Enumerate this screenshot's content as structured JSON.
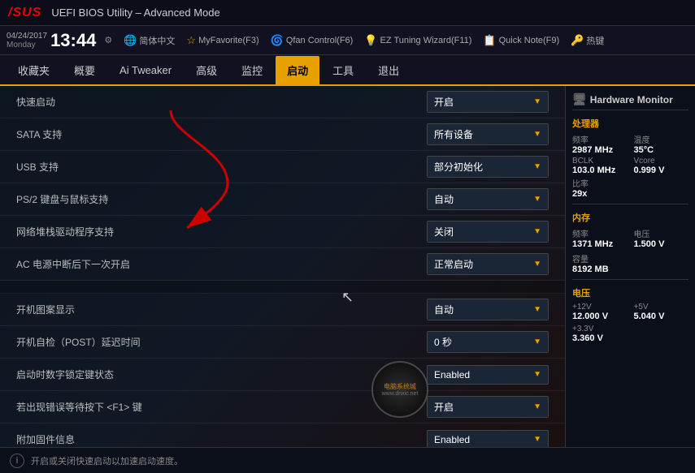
{
  "titlebar": {
    "logo": "/SUS",
    "title": "UEFI BIOS Utility – Advanced Mode"
  },
  "toolbar": {
    "datetime": "13:44",
    "date": "04/24/2017",
    "day": "Monday",
    "items": [
      {
        "icon": "🌐",
        "label": "简体中文"
      },
      {
        "icon": "⭐",
        "label": "MyFavorite(F3)"
      },
      {
        "icon": "🌀",
        "label": "Qfan Control(F6)"
      },
      {
        "icon": "💡",
        "label": "EZ Tuning Wizard(F11)"
      },
      {
        "icon": "📝",
        "label": "Quick Note(F9)"
      },
      {
        "icon": "🔑",
        "label": "热键"
      }
    ]
  },
  "nav": {
    "items": [
      {
        "label": "收藏夹",
        "active": false
      },
      {
        "label": "概要",
        "active": false
      },
      {
        "label": "Ai Tweaker",
        "active": false
      },
      {
        "label": "高级",
        "active": false
      },
      {
        "label": "监控",
        "active": false
      },
      {
        "label": "启动",
        "active": true
      },
      {
        "label": "工具",
        "active": false
      },
      {
        "label": "退出",
        "active": false
      }
    ]
  },
  "settings": {
    "rows": [
      {
        "type": "setting",
        "label": "快速启动",
        "value": "开启"
      },
      {
        "type": "setting",
        "label": "SATA 支持",
        "value": "所有设备"
      },
      {
        "type": "setting",
        "label": "USB 支持",
        "value": "部分初始化"
      },
      {
        "type": "setting",
        "label": "PS/2 键盘与鼠标支持",
        "value": "自动"
      },
      {
        "type": "setting",
        "label": "网络堆栈驱动程序支持",
        "value": "关闭"
      },
      {
        "type": "setting",
        "label": "AC 电源中断后下一次开启",
        "value": "正常启动"
      },
      {
        "type": "spacer"
      },
      {
        "type": "setting",
        "label": "开机图案显示",
        "value": "自动"
      },
      {
        "type": "setting",
        "label": "开机自检（POST）延迟时间",
        "value": "0 秒"
      },
      {
        "type": "setting",
        "label": "启动时数字锁定键状态",
        "value": "Enabled"
      },
      {
        "type": "setting",
        "label": "若出现错误等待按下 <F1> 键",
        "value": "开启"
      },
      {
        "type": "setting",
        "label": "附加固件信息",
        "value": "Enabled"
      }
    ]
  },
  "status_bar": {
    "text": "开启或关闭快速启动以加速启动速度。"
  },
  "hardware_monitor": {
    "title": "Hardware Monitor",
    "processor": {
      "title": "处理器",
      "freq_label": "频率",
      "freq_value": "2987 MHz",
      "temp_label": "温度",
      "temp_value": "35°C",
      "bclk_label": "BCLK",
      "bclk_value": "103.0 MHz",
      "vcore_label": "Vcore",
      "vcore_value": "0.999 V",
      "ratio_label": "比率",
      "ratio_value": "29x"
    },
    "memory": {
      "title": "内存",
      "freq_label": "频率",
      "freq_value": "1371 MHz",
      "volt_label": "电压",
      "volt_value": "1.500 V",
      "cap_label": "容量",
      "cap_value": "8192 MB"
    },
    "voltage": {
      "title": "电压",
      "v12_label": "+12V",
      "v12_value": "12.000 V",
      "v5_label": "+5V",
      "v5_value": "5.040 V",
      "v33_label": "+3.3V",
      "v33_value": "3.360 V"
    }
  }
}
